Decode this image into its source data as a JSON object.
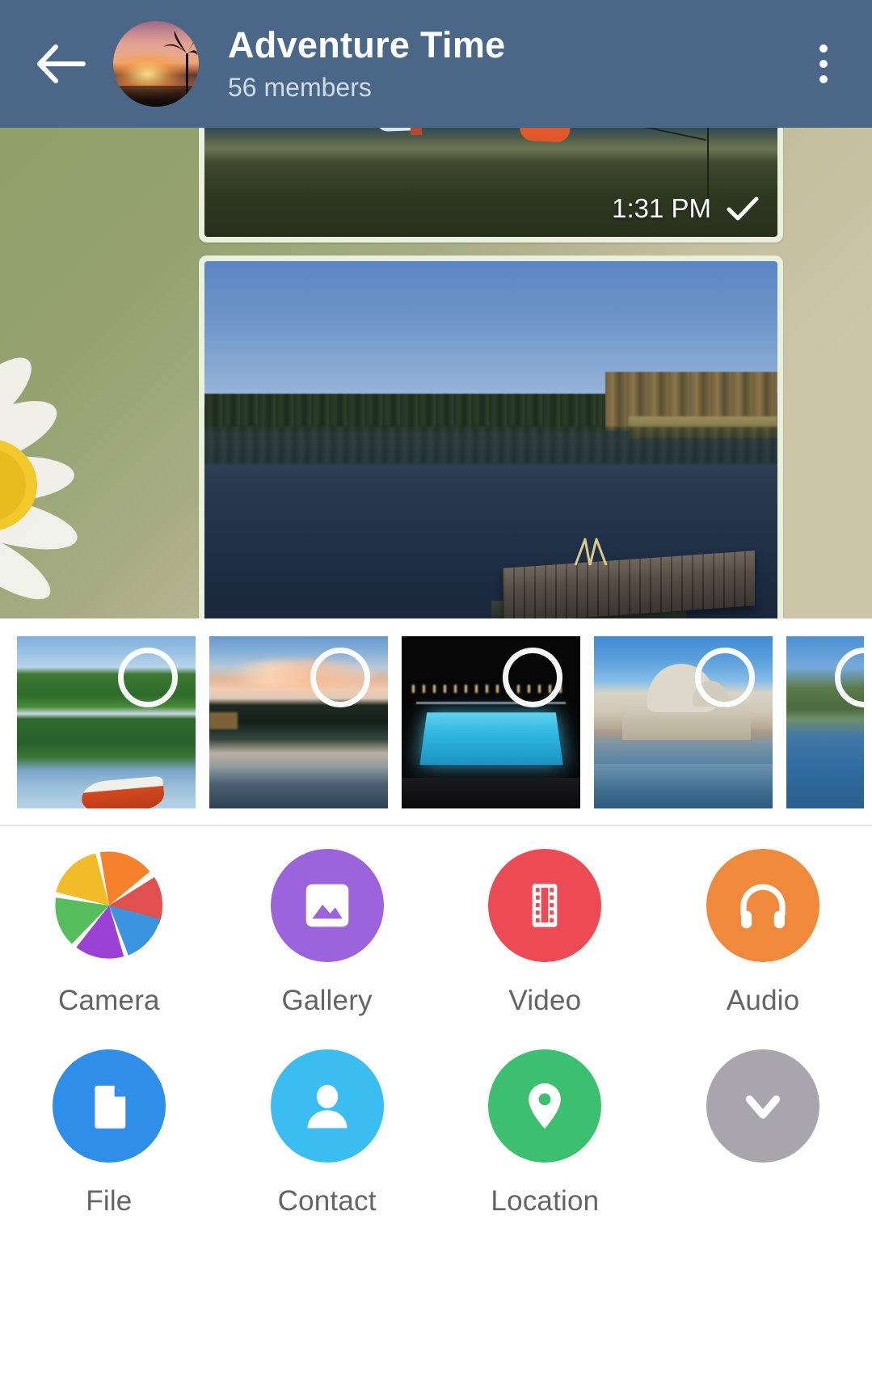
{
  "header": {
    "back_icon": "back-arrow-icon",
    "avatar_icon": "group-avatar-image",
    "title": "Adventure Time",
    "subtitle": "56 members",
    "menu_icon": "overflow-menu-icon",
    "background_color": "#4a6788",
    "title_color": "#ffffff",
    "subtitle_color": "#cfdbe8"
  },
  "chat": {
    "wallpaper_colors": [
      "#8fa06a",
      "#cdc5a8"
    ],
    "bubble_color": "#e9f0dc",
    "messages": [
      {
        "id": "msg-photo-shore",
        "type": "photo",
        "description": "shore-with-boats-photo",
        "time": "1:31 PM",
        "status_icon": "single-check-icon"
      },
      {
        "id": "msg-photo-lake",
        "type": "photo",
        "description": "lake-with-pier-photo",
        "time": "",
        "status_icon": ""
      }
    ]
  },
  "thumbnail_strip": {
    "selection_icon": "selection-circle-icon",
    "thumbnails": [
      {
        "id": "thumb-1",
        "name": "forest-lake-with-red-boat",
        "selected": false
      },
      {
        "id": "thumb-2",
        "name": "sunset-lake-reflection",
        "selected": false
      },
      {
        "id": "thumb-3",
        "name": "night-swimming-pool",
        "selected": false
      },
      {
        "id": "thumb-4",
        "name": "venice-basilica",
        "selected": false
      },
      {
        "id": "thumb-5",
        "name": "coastal-water-partial",
        "selected": false
      }
    ]
  },
  "attach_panel": {
    "background_color": "#ffffff",
    "label_color": "#646464",
    "items": [
      {
        "label": "Camera",
        "icon": "camera-shutter-icon",
        "color": "#ffffff"
      },
      {
        "label": "Gallery",
        "icon": "gallery-image-icon",
        "color": "#9b64dd"
      },
      {
        "label": "Video",
        "icon": "video-film-icon",
        "color": "#ec4a55"
      },
      {
        "label": "Audio",
        "icon": "audio-headphones-icon",
        "color": "#ef8a3c"
      },
      {
        "label": "File",
        "icon": "file-document-icon",
        "color": "#2f8fe8"
      },
      {
        "label": "Contact",
        "icon": "contact-person-icon",
        "color": "#3cbdf2"
      },
      {
        "label": "Location",
        "icon": "location-pin-icon",
        "color": "#3cbf6e"
      },
      {
        "label": "",
        "icon": "chevron-down-icon",
        "color": "#a9a5ad"
      }
    ],
    "shutter_colors": [
      "#f5812a",
      "#e0504f",
      "#3c93e0",
      "#9b42d4",
      "#56bd5c",
      "#f2bb28"
    ]
  }
}
